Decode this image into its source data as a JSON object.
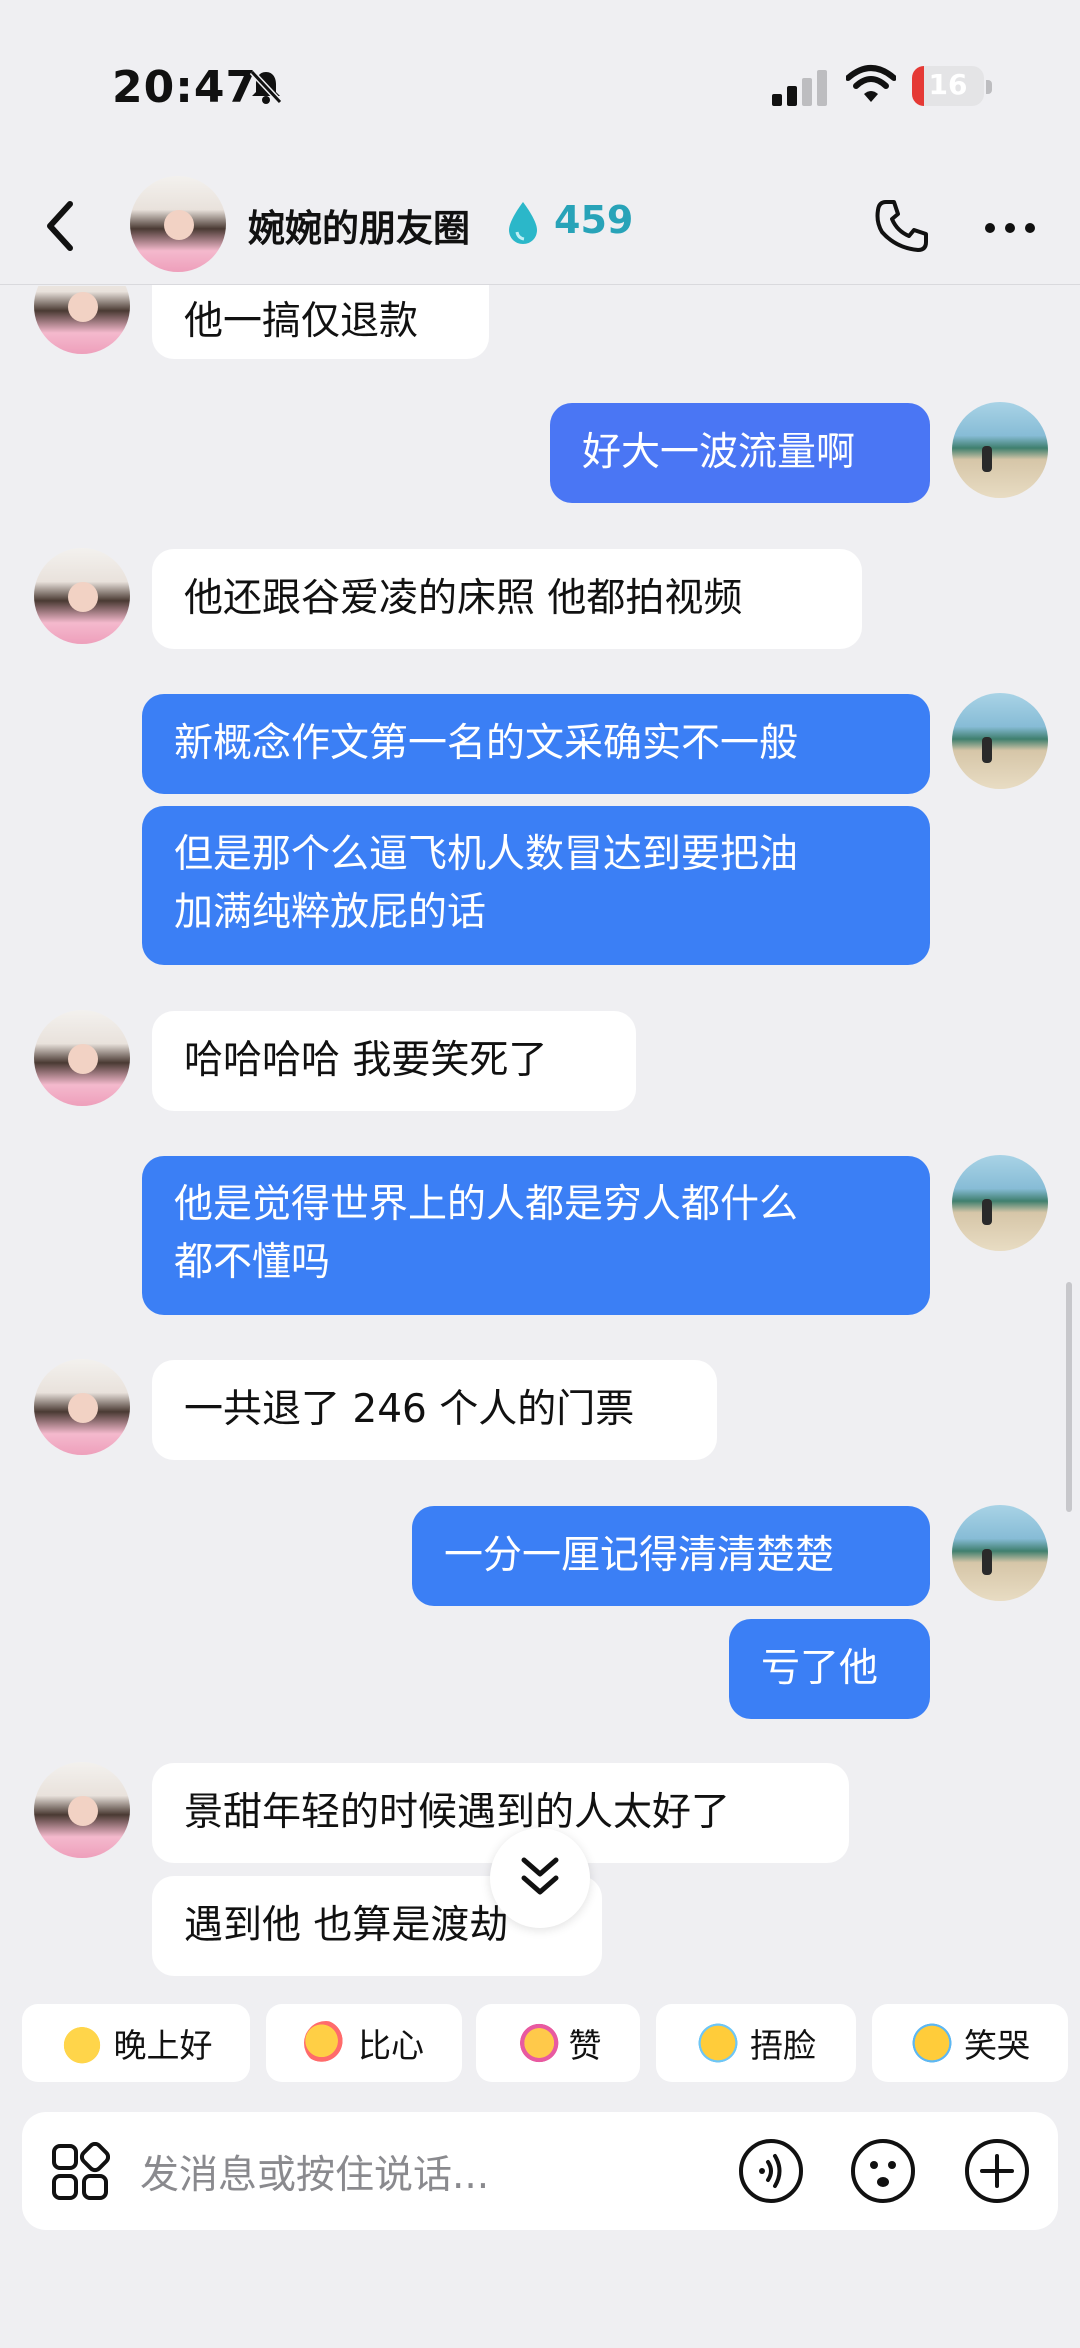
{
  "status_bar": {
    "time": "20:47",
    "battery": "16",
    "battery_level": 0.16
  },
  "header": {
    "title": "婉婉的朋友圈",
    "streak_count": "459"
  },
  "messages": [
    {
      "side": "in",
      "text": "他一搞仅退款"
    },
    {
      "side": "out",
      "text": "好大一波流量啊"
    },
    {
      "side": "in",
      "text": "他还跟谷爱凌的床照 他都拍视频"
    },
    {
      "side": "out",
      "text": "新概念作文第一名的文采确实不一般"
    },
    {
      "side": "out",
      "text_line1": "但是那个么逼飞机人数冒达到要把油",
      "text_line2": "加满纯粹放屁的话"
    },
    {
      "side": "in",
      "text": "哈哈哈哈 我要笑死了"
    },
    {
      "side": "out",
      "text_line1": "他是觉得世界上的人都是穷人都什么",
      "text_line2": "都不懂吗"
    },
    {
      "side": "in",
      "text": "一共退了 246 个人的门票"
    },
    {
      "side": "out",
      "text": "一分一厘记得清清楚楚"
    },
    {
      "side": "out",
      "text": "亏了他"
    },
    {
      "side": "in",
      "text": "景甜年轻的时候遇到的人太好了"
    },
    {
      "side": "in",
      "text": "遇到他  也算是渡劫"
    }
  ],
  "quick_replies": [
    {
      "label": "晚上好",
      "icon": "star-face-icon"
    },
    {
      "label": "比心",
      "icon": "heart-hand-icon"
    },
    {
      "label": "赞",
      "icon": "thumbs-up-icon"
    },
    {
      "label": "捂脸",
      "icon": "facepalm-icon"
    },
    {
      "label": "笑哭",
      "icon": "tears-of-joy-icon"
    }
  ],
  "input": {
    "placeholder": "发消息或按住说话..."
  },
  "colors": {
    "outgoing_bubble": "#4a76f4",
    "incoming_bubble": "#ffffff",
    "background": "#efeff2",
    "streak": "#28a3b8",
    "battery_low": "#e53935"
  }
}
